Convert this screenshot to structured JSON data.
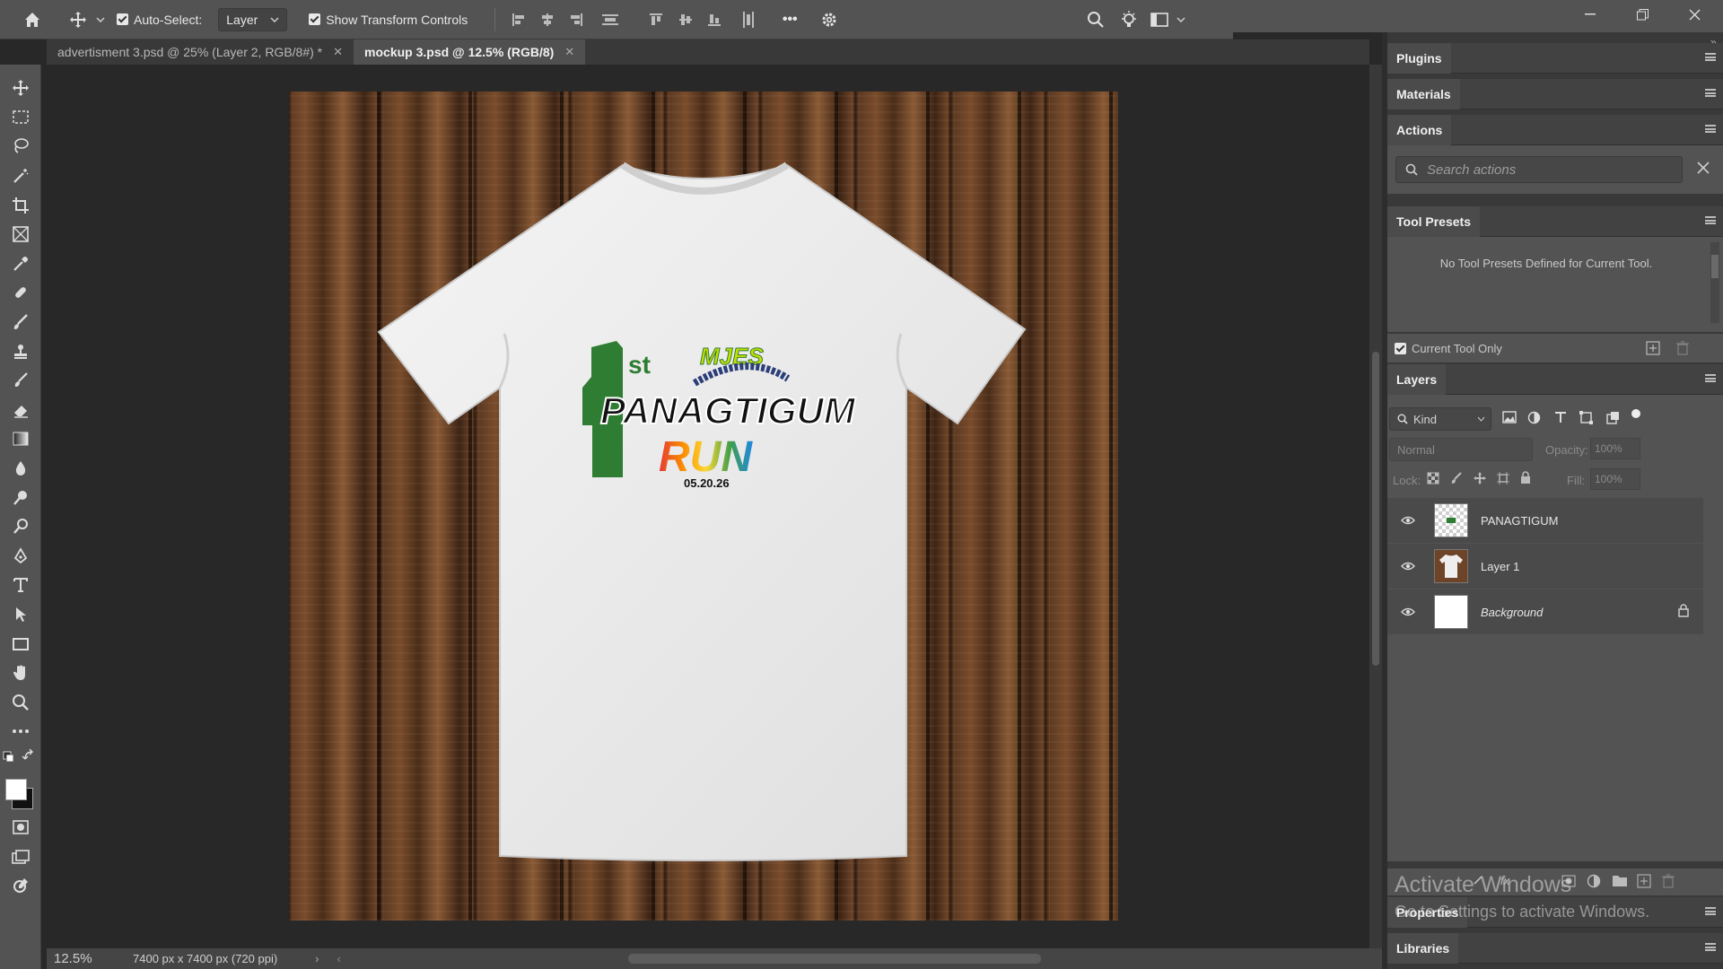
{
  "options_bar": {
    "auto_select_label": "Auto-Select:",
    "auto_select_target": "Layer",
    "transform_label": "Show Transform Controls",
    "more": "•••"
  },
  "tabs": [
    {
      "label": "advertisment 3.psd @ 25% (Layer 2, RGB/8#) *"
    },
    {
      "label": "mockup 3.psd @ 12.5% (RGB/8)"
    }
  ],
  "status": {
    "zoom": "12.5%",
    "doc_info": "7400 px x 7400 px (720 ppi)"
  },
  "artwork": {
    "first": "1",
    "first_suffix": "st",
    "brand": "MJES",
    "title_main": "PANAGTIGUM",
    "title_run": "RUN",
    "date": "05.20.26"
  },
  "panels": {
    "plugins": "Plugins",
    "materials": "Materials",
    "actions": "Actions",
    "actions_search_placeholder": "Search actions",
    "tool_presets": "Tool Presets",
    "no_presets": "No Tool Presets Defined for Current Tool.",
    "current_tool_only": "Current Tool Only",
    "layers": "Layers",
    "kind": "Kind",
    "blend_mode": "Normal",
    "opacity_label": "Opacity:",
    "opacity_value": "100%",
    "lock_label": "Lock:",
    "fill_label": "Fill:",
    "fill_value": "100%",
    "properties": "Properties",
    "libraries": "Libraries"
  },
  "layers": [
    {
      "name": "PANAGTIGUM"
    },
    {
      "name": "Layer 1"
    },
    {
      "name": "Background"
    }
  ],
  "watermark": {
    "title": "Activate Windows",
    "subtitle": "Go to Settings to activate Windows."
  }
}
